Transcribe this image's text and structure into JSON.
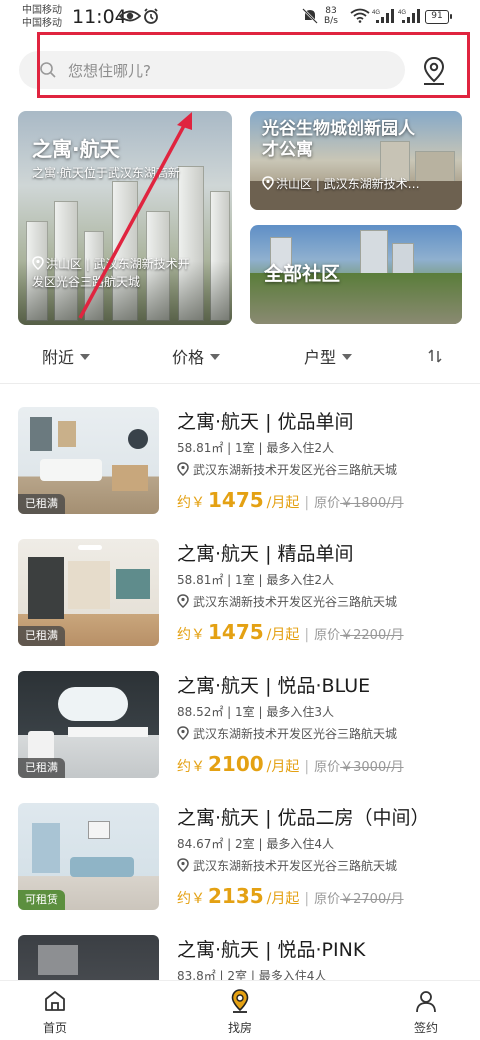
{
  "status_bar": {
    "carrier_1": "中国移动",
    "carrier_2": "中国移动",
    "time": "11:04",
    "speed_value": "83",
    "speed_unit": "B/s",
    "battery": "91"
  },
  "search": {
    "placeholder": "您想住哪儿?"
  },
  "banners": {
    "main": {
      "title": "之寓·航天",
      "subtitle": "之寓·航天位于武汉东湖高新",
      "location_line1": "洪山区 | 武汉东湖新技术开",
      "location_line2": "发区光谷三路航天城"
    },
    "bio": {
      "title_line1": "光谷生物城创新园人",
      "title_line2": "才公寓",
      "location": "洪山区 | 武汉东湖新技术…"
    },
    "all": {
      "title": "全部社区"
    }
  },
  "filters": {
    "nearby": "附近",
    "price": "价格",
    "layout": "户型"
  },
  "listings": [
    {
      "title": "之寓·航天 | 优品单间",
      "meta": "58.81㎡ | 1室 | 最多入住2人",
      "address": "武汉东湖新技术开发区光谷三路航天城",
      "status": "已租满",
      "price_prefix": "约￥",
      "price": "1475",
      "price_suffix": "/月起",
      "orig_label": "原价",
      "orig_price": "￥1800/月"
    },
    {
      "title": "之寓·航天 | 精品单间",
      "meta": "58.81㎡ | 1室 | 最多入住2人",
      "address": "武汉东湖新技术开发区光谷三路航天城",
      "status": "已租满",
      "price_prefix": "约￥",
      "price": "1475",
      "price_suffix": "/月起",
      "orig_label": "原价",
      "orig_price": "￥2200/月"
    },
    {
      "title": "之寓·航天 | 悦品·BLUE",
      "meta": "88.52㎡ | 1室 | 最多入住3人",
      "address": "武汉东湖新技术开发区光谷三路航天城",
      "status": "已租满",
      "price_prefix": "约￥",
      "price": "2100",
      "price_suffix": "/月起",
      "orig_label": "原价",
      "orig_price": "￥3000/月"
    },
    {
      "title": "之寓·航天 | 优品二房（中间）",
      "meta": "84.67㎡ | 2室 | 最多入住4人",
      "address": "武汉东湖新技术开发区光谷三路航天城",
      "status": "可租赁",
      "price_prefix": "约￥",
      "price": "2135",
      "price_suffix": "/月起",
      "orig_label": "原价",
      "orig_price": "￥2700/月"
    },
    {
      "title": "之寓·航天 | 悦品·PINK",
      "meta": "83.8㎡ | 2室 | 最多入住4人"
    }
  ],
  "nav": {
    "home": "首页",
    "find": "找房",
    "contract": "签约"
  },
  "colors": {
    "accent": "#e4a113",
    "highlight": "#e0243f",
    "tag_available": "#5c8f3f"
  }
}
